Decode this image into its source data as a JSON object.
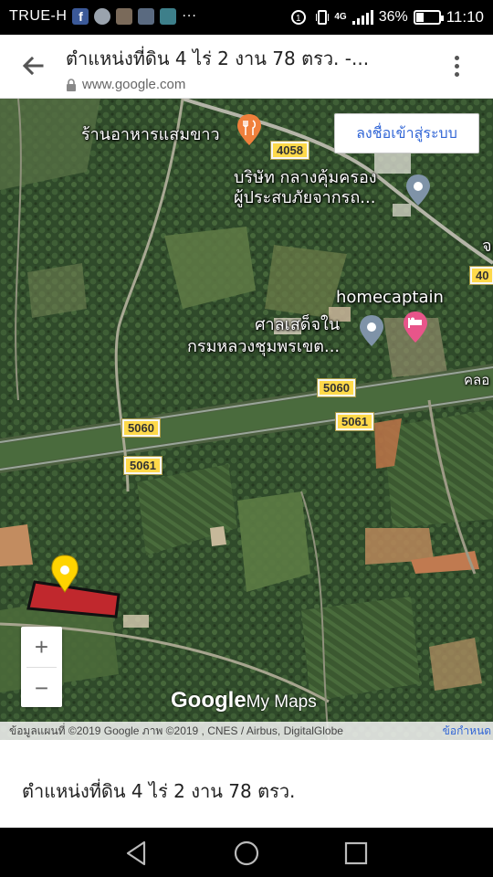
{
  "status_bar": {
    "carrier": "TRUE-H",
    "notif_icons": [
      "facebook-icon",
      "circle-app-icon",
      "photo-icon",
      "gallery-icon",
      "download-icon"
    ],
    "more": "···",
    "network": "4G",
    "battery_percent": "36%",
    "battery_level": 0.36,
    "time": "11:10"
  },
  "title_bar": {
    "title": "ตำแหน่งที่ดิน 4 ไร่ 2 งาน 78 ตรว. -...",
    "url": "www.google.com"
  },
  "map": {
    "signin_label": "ลงชื่อเข้าสู่ระบบ",
    "labels": {
      "restaurant": "ร้านอาหารแสมขาว",
      "company_line1": "บริษัท กลางคุ้มครอง",
      "company_line2": "ผู้ประสบภัยจากรถ...",
      "hotel": "homecaptain",
      "shrine_line1": "ศาลเสด็จใน",
      "shrine_line2": "กรมหลวงชุมพรเขต...",
      "canal_fragment": "คลอ",
      "edge_fragment": "จ"
    },
    "road_shields": {
      "r4058": "4058",
      "r40_edge": "40",
      "r5060_a": "5060",
      "r5060_b": "5060",
      "r5061_a": "5061",
      "r5061_b": "5061"
    },
    "zoom_in": "+",
    "zoom_out": "−",
    "brand_google": "Google",
    "brand_mymaps": "My Maps",
    "attribution": "ข้อมูลแผนที่ ©2019 Google ภาพ ©2019 , CNES / Airbus, DigitalGlobe",
    "attribution_link": "ข้อกำหนด",
    "colors": {
      "parcel_fill": "#c0282d",
      "marker": "#ffd400",
      "poi_gray": "#7f93a8",
      "poi_hotel": "#e8558a",
      "poi_food": "#f0803c",
      "road_shield": "#fed94a"
    }
  },
  "info_panel": {
    "title": "ตำแหน่งที่ดิน 4 ไร่ 2 งาน 78 ตรว."
  }
}
